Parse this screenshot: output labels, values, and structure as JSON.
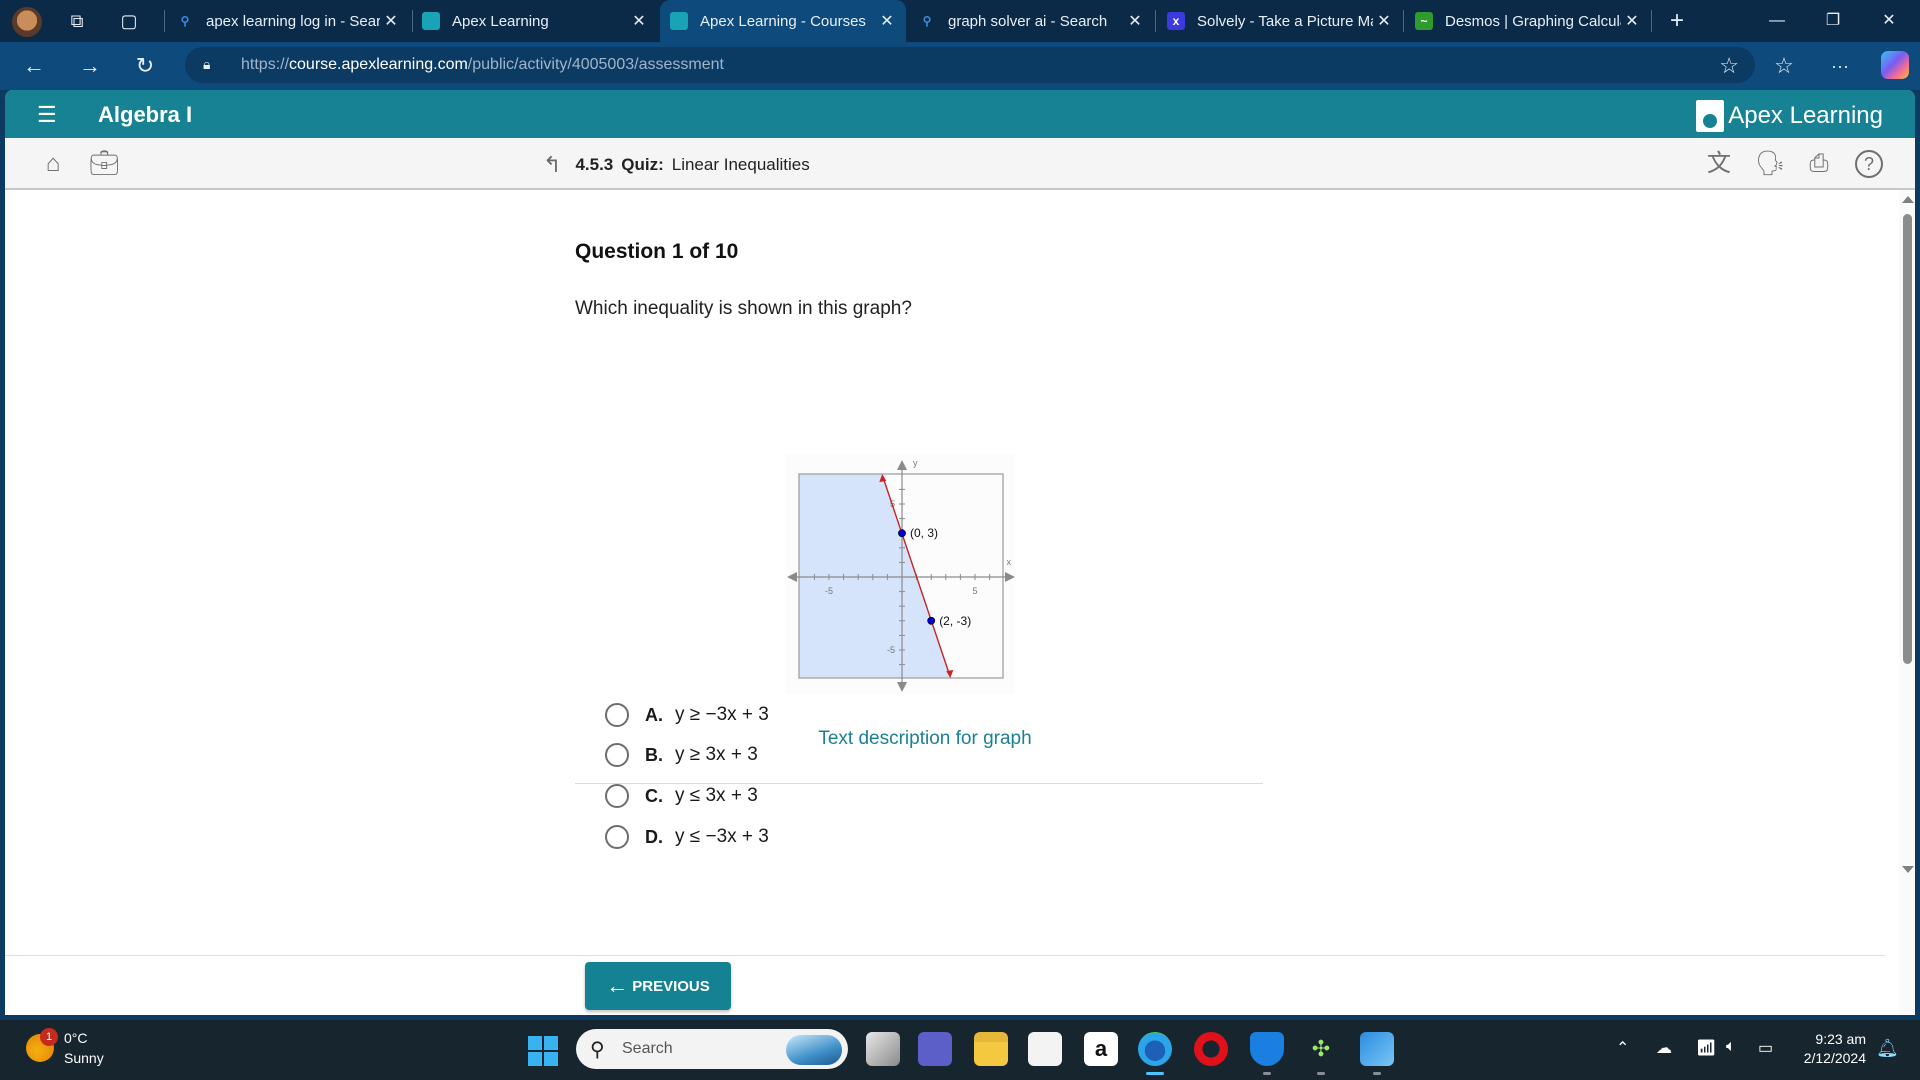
{
  "browser": {
    "tabs": [
      {
        "title": "apex learning log in - Search",
        "favicon": "search-icon",
        "active": false
      },
      {
        "title": "Apex Learning",
        "favicon": "apex-favicon",
        "active": false
      },
      {
        "title": "Apex Learning - Courses",
        "favicon": "apex-favicon",
        "active": true
      },
      {
        "title": "graph solver ai - Search",
        "favicon": "search-icon",
        "active": false
      },
      {
        "title": "Solvely - Take a Picture Math",
        "favicon": "solvely-favicon",
        "active": false
      },
      {
        "title": "Desmos | Graphing Calculator",
        "favicon": "desmos-favicon",
        "active": false
      }
    ],
    "new_tab_label": "+",
    "url_prefix": "https://",
    "url_host": "course.apexlearning.com",
    "url_path": "/public/activity/4005003/assessment"
  },
  "app": {
    "course_title": "Algebra I",
    "brand": "Apex Learning",
    "breadcrumb": {
      "number": "4.5.3",
      "kind": "Quiz:",
      "title": "Linear Inequalities"
    },
    "colors": {
      "teal": "#168294",
      "link": "#1b8195",
      "shade": "#d6e4fb",
      "line": "#cc2222",
      "point": "#0000cc"
    }
  },
  "question": {
    "header": "Question 1 of 10",
    "prompt": "Which inequality is shown in this graph?",
    "graph_link": "Text description for graph",
    "choices": [
      {
        "letter": "A.",
        "expr": "y ≥ −3x + 3"
      },
      {
        "letter": "B.",
        "expr": "y ≥ 3x + 3"
      },
      {
        "letter": "C.",
        "expr": "y ≤ 3x + 3"
      },
      {
        "letter": "D.",
        "expr": "y ≤ −3x + 3"
      }
    ],
    "previous_label": "PREVIOUS"
  },
  "chart_data": {
    "type": "line",
    "title": "",
    "xlabel": "x",
    "ylabel": "y",
    "xlim": [
      -7,
      7
    ],
    "ylim": [
      -7,
      7
    ],
    "x_tick_labels": [
      -5,
      5
    ],
    "y_tick_labels": [
      5,
      -5
    ],
    "line": {
      "slope": -3,
      "intercept": 3,
      "style": "solid"
    },
    "shaded_region": "below-left of line",
    "points": [
      {
        "x": 0,
        "y": 3,
        "label": "(0, 3)"
      },
      {
        "x": 2,
        "y": -3,
        "label": "(2, -3)"
      }
    ]
  },
  "taskbar": {
    "weather_temp": "0°C",
    "weather_cond": "Sunny",
    "weather_badge": "1",
    "search_label": "Search",
    "time": "9:23 am",
    "date": "2/12/2024"
  }
}
